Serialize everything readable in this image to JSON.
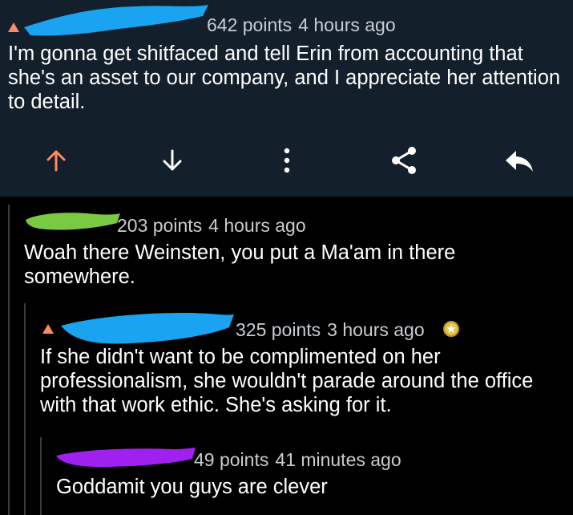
{
  "colors": {
    "top_bg": "#131f2b",
    "page_bg": "#000000",
    "upvote_orange": "#ff8b60",
    "meta_gray": "#c8cdd2",
    "redact_blue": "#1aa3f0",
    "redact_green": "#7ac943",
    "redact_purple": "#a020f0"
  },
  "comments": [
    {
      "points": "642 points",
      "age": "4 hours ago",
      "body": "I'm gonna get shitfaced and tell Erin from accounting that she's an asset to our company, and I appreciate her attention to detail."
    },
    {
      "points": "203 points",
      "age": "4 hours ago",
      "body": "Woah there Weinsten, you put a Ma'am in there somewhere."
    },
    {
      "points": "325 points",
      "age": "3 hours ago",
      "body": "If she didn't want to be complimented on her professionalism, she wouldn't parade around the office with that work ethic. She's asking for it."
    },
    {
      "points": "49 points",
      "age": "41 minutes ago",
      "body": "Goddamit you guys are clever"
    }
  ],
  "actions": {
    "upvote_icon": "upvote-arrow-icon",
    "downvote_icon": "downvote-arrow-icon",
    "more_icon": "more-vertical-icon",
    "share_icon": "share-icon",
    "reply_icon": "reply-icon"
  }
}
